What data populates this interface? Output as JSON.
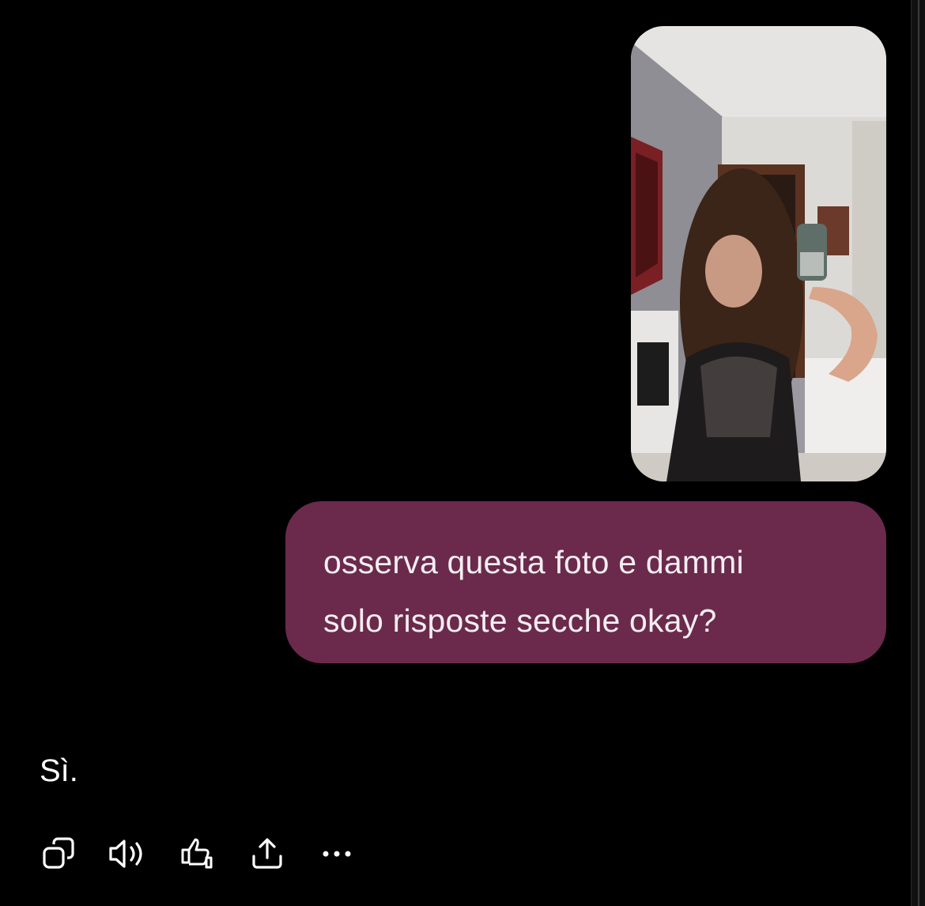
{
  "conversation": {
    "user_message": {
      "attachment_icon": "photo-thumbnail",
      "text": "osserva questa foto e dammi\nsolo risposte secche okay?"
    },
    "assistant_message": {
      "text": "Sì."
    }
  },
  "actions": [
    {
      "icon": "copy-icon"
    },
    {
      "icon": "speaker-icon"
    },
    {
      "icon": "thumbs-down-icon"
    },
    {
      "icon": "share-icon"
    },
    {
      "icon": "more-icon"
    }
  ],
  "colors": {
    "background": "#000000",
    "user_bubble": "#6b2a4b",
    "text": "#ffffff"
  }
}
